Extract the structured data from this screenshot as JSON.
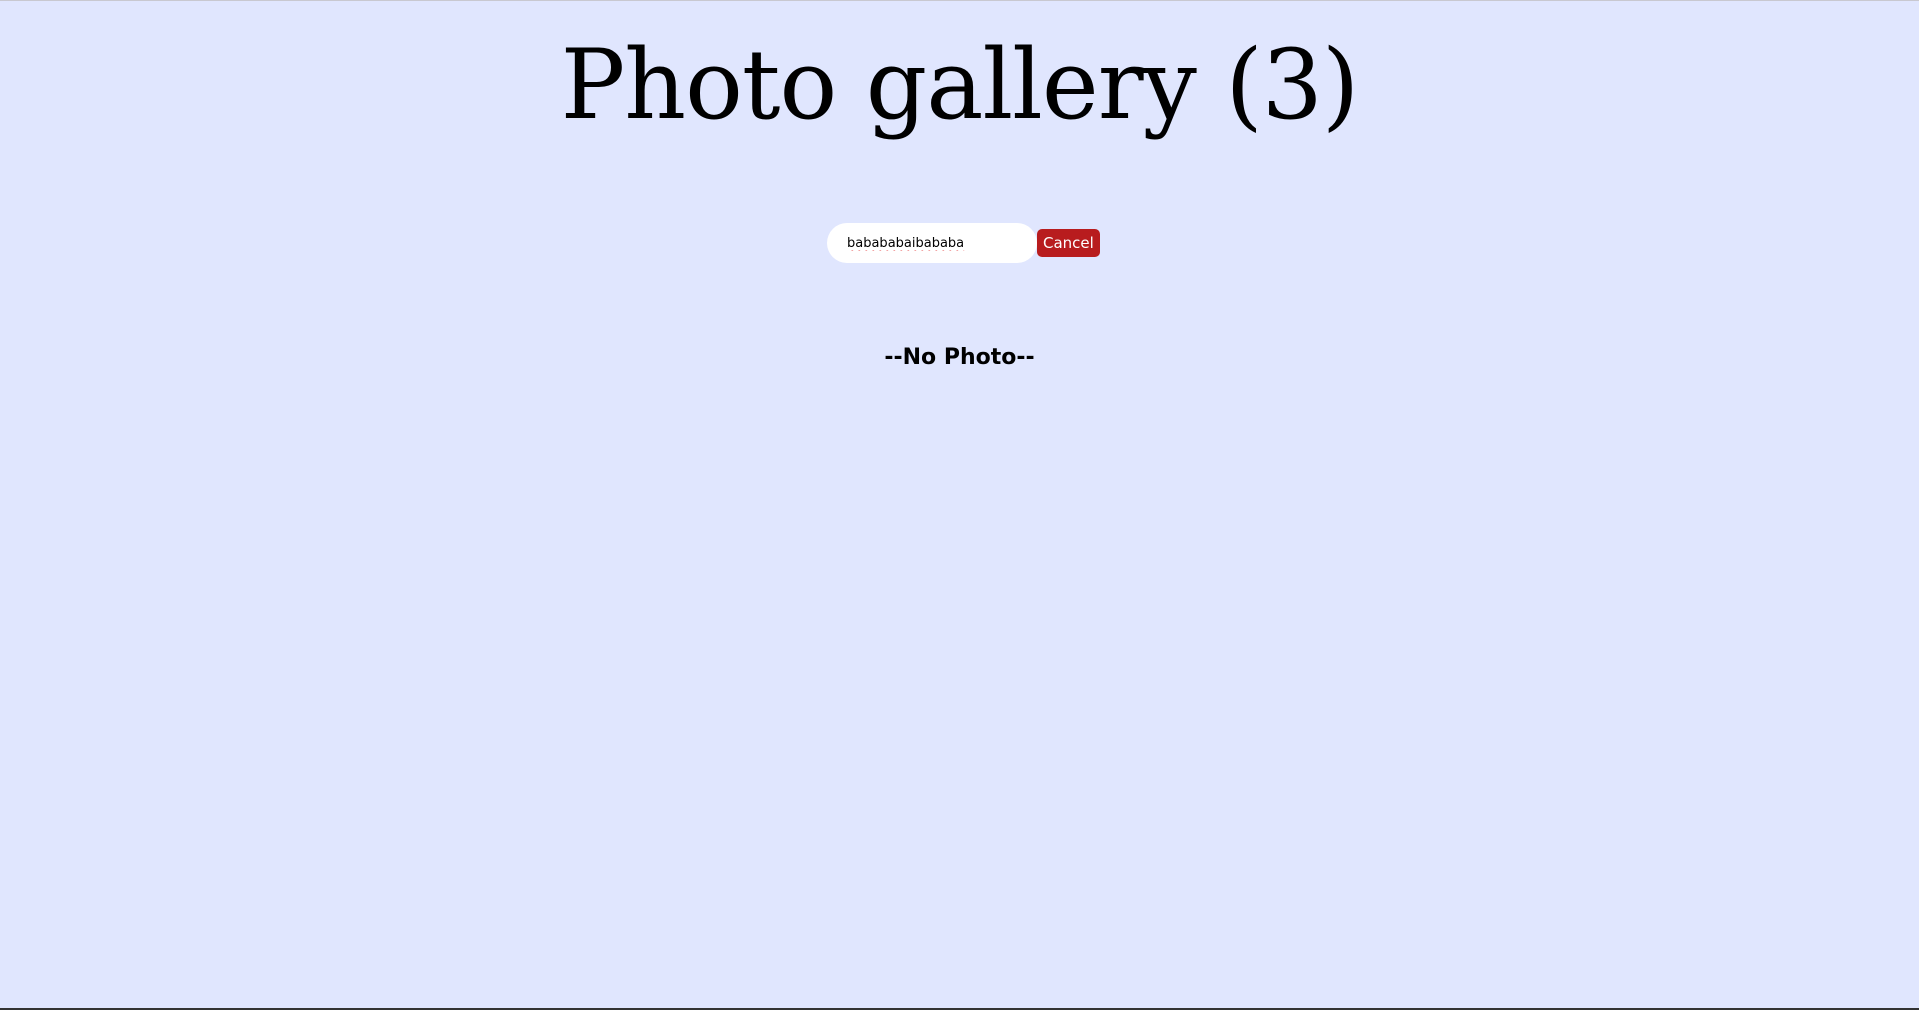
{
  "header": {
    "title": "Photo gallery (3)"
  },
  "search": {
    "value": "babababaibababa",
    "cancel_label": "Cancel"
  },
  "gallery": {
    "empty_message": "--No Photo--"
  },
  "colors": {
    "background": "#e0e6fe",
    "cancel_button": "#b81c1e"
  }
}
